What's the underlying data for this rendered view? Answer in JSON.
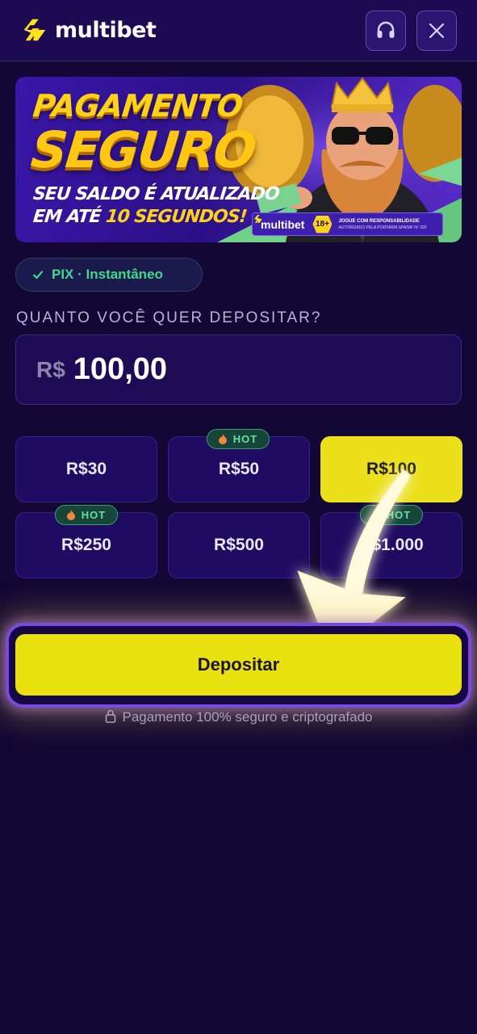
{
  "header": {
    "logo_text": "multibet",
    "support_icon": "headset-icon",
    "close_icon": "close-icon"
  },
  "banner": {
    "title_line1": "PAGAMENTO",
    "title_line2": "SEGURO",
    "subtitle_line1": "SEU SALDO É ATUALIZADO",
    "subtitle_line2_prefix": "EM ATÉ ",
    "subtitle_line2_highlight": "10 SEGUNDOS!",
    "badge_logo": "multibet",
    "age": "18+",
    "responsibility_line1": "JOGUE COM RESPONSABILIDADE",
    "responsibility_line2": "AUTORIZADO PELA PORTARIA SPA/MF Nº 320"
  },
  "payment_method": {
    "label": "PIX · Instantâneo",
    "icon": "check-icon"
  },
  "deposit": {
    "question": "QUANTO VOCÊ QUER DEPOSITAR?",
    "currency": "R$",
    "amount": "100,00"
  },
  "presets": [
    {
      "label": "R$30",
      "hot": false,
      "selected": false
    },
    {
      "label": "R$50",
      "hot": true,
      "selected": false
    },
    {
      "label": "R$100",
      "hot": false,
      "selected": true
    },
    {
      "label": "R$250",
      "hot": true,
      "selected": false
    },
    {
      "label": "R$500",
      "hot": false,
      "selected": false
    },
    {
      "label": "R$1.000",
      "hot": true,
      "selected": false
    }
  ],
  "hot_label": "HOT",
  "submit": {
    "label": "Depositar"
  },
  "security_note": "Pagamento 100% seguro e criptografado",
  "colors": {
    "background": "#120735",
    "accent_yellow": "#e8e00f",
    "hot_green": "#62e0a6",
    "purple_border": "#7b48e0"
  }
}
